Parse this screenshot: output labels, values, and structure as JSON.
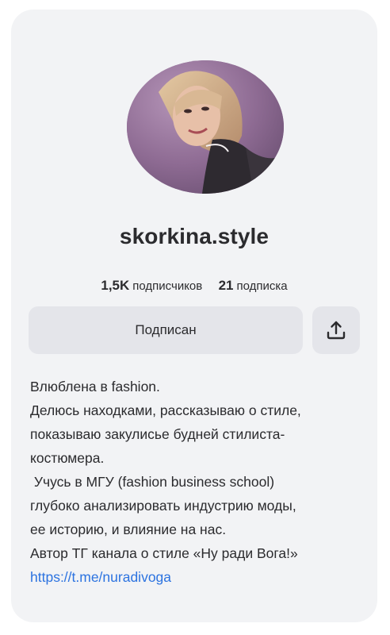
{
  "profile": {
    "username": "skorkina.style",
    "followers_count": "1,5K",
    "followers_label": "подписчиков",
    "following_count": "21",
    "following_label": "подписка"
  },
  "actions": {
    "subscribe_label": "Подписан",
    "share_icon": "share-upload-icon"
  },
  "bio": {
    "lines": [
      "Влюблена в fashion.",
      "Делюсь находками, рассказываю о стиле,",
      "показываю закулисье будней стилиста-",
      "костюмера.",
      " Учусь в МГУ (fashion business school)",
      "глубоко анализировать индустрию моды,",
      "ее историю, и влияние на нас.",
      "Автор ТГ канала о стиле «Ну ради Вога!»"
    ],
    "link": "https://t.me/nuradivoga"
  },
  "colors": {
    "card_bg": "#f2f3f5",
    "button_bg": "#e4e5ea",
    "text": "#2b2b2e",
    "link": "#2c73e0"
  }
}
